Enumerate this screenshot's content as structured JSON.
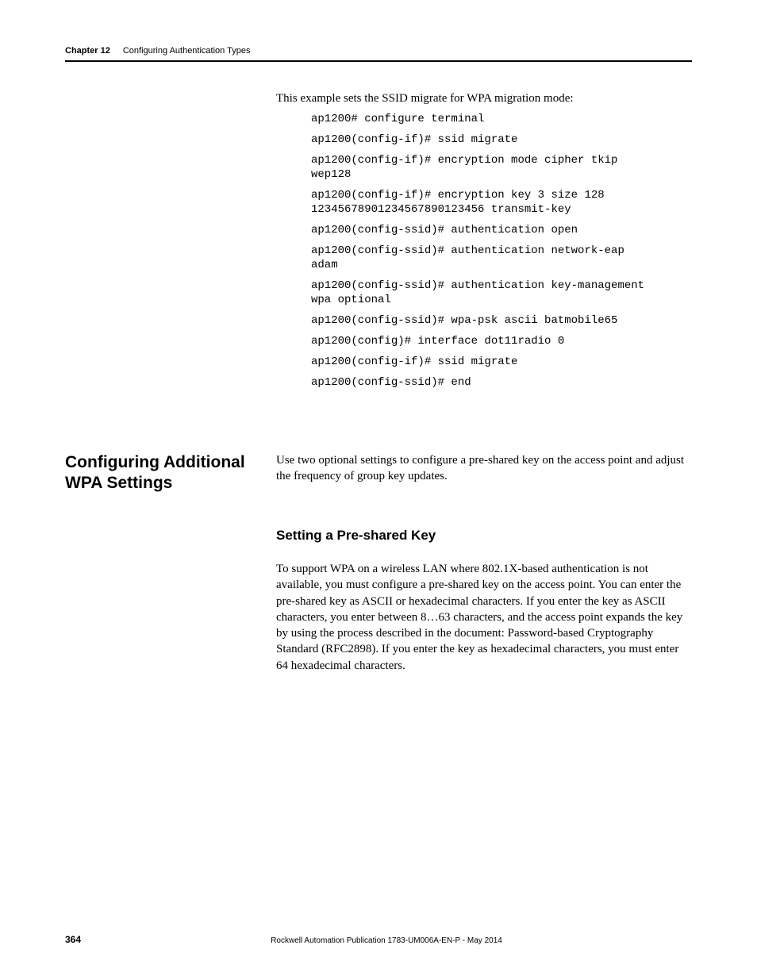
{
  "header": {
    "chapter_label": "Chapter 12",
    "chapter_title": "Configuring Authentication Types"
  },
  "intro": "This example sets the SSID migrate for WPA migration mode:",
  "code": {
    "l1": "ap1200# configure terminal",
    "l2": "ap1200(config-if)# ssid migrate",
    "l3": "ap1200(config-if)# encryption mode cipher tkip\nwep128",
    "l4": "ap1200(config-if)# encryption key 3 size 128\n12345678901234567890123456 transmit-key",
    "l5": "ap1200(config-ssid)# authentication open",
    "l6": "ap1200(config-ssid)# authentication network-eap\nadam",
    "l7": "ap1200(config-ssid)# authentication key-management\nwpa optional",
    "l8": "ap1200(config-ssid)# wpa-psk ascii batmobile65",
    "l9": "ap1200(config)# interface dot11radio 0",
    "l10": "ap1200(config-if)# ssid migrate",
    "l11": "ap1200(config-ssid)# end"
  },
  "section": {
    "heading": "Configuring Additional WPA Settings",
    "body": "Use two optional settings to configure a pre-shared key on the access point and adjust the frequency of group key updates."
  },
  "subsection": {
    "heading": "Setting a Pre-shared Key",
    "body": "To support WPA on a wireless LAN where 802.1X-based authentication is not available, you must configure a pre-shared key on the access point. You can enter the pre-shared key as ASCII or hexadecimal characters. If you enter the key as ASCII characters, you enter between 8…63 characters, and the access point expands the key by using the process described in the document: Password-based Cryptography Standard (RFC2898). If you enter the key as hexadecimal characters, you must enter 64 hexadecimal characters."
  },
  "footer": {
    "page": "364",
    "pub": "Rockwell Automation Publication 1783-UM006A-EN-P - May 2014"
  }
}
